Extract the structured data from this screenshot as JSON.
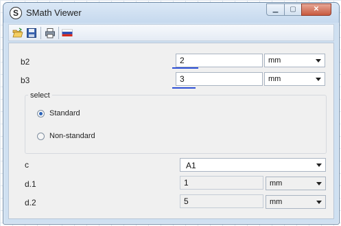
{
  "window": {
    "title": "SMath Viewer",
    "app_icon_glyph": "S"
  },
  "titlebar_buttons": {
    "minimize": "▁",
    "maximize": "▢",
    "close": "✕"
  },
  "toolbar": {
    "icons": [
      "open-folder-icon",
      "save-icon",
      "print-icon",
      "russian-flag-icon"
    ]
  },
  "fields": {
    "b2": {
      "label": "b2",
      "value": "2",
      "unit": "mm"
    },
    "b3": {
      "label": "b3",
      "value": "3",
      "unit": "mm"
    },
    "c": {
      "label": "c",
      "value": "A1"
    },
    "d1": {
      "label": "d.1",
      "value": "1",
      "unit": "mm"
    },
    "d2": {
      "label": "d.2",
      "value": "5",
      "unit": "mm"
    }
  },
  "select_group": {
    "title": "select",
    "options": [
      {
        "label": "Standard",
        "selected": true
      },
      {
        "label": "Non-standard",
        "selected": false
      }
    ]
  },
  "colors": {
    "underline": "#2d4fd6",
    "close_button": "#c85a3f"
  }
}
